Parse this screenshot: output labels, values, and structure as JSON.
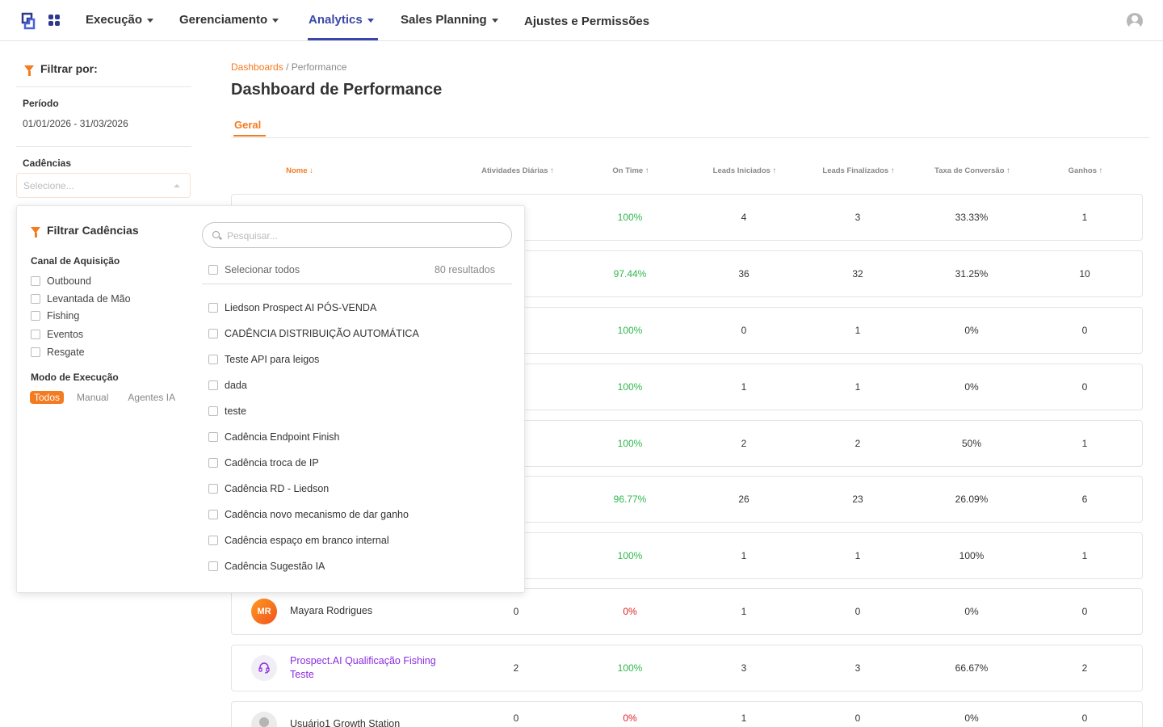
{
  "nav": {
    "items": [
      {
        "label": "Execução",
        "has_caret": true
      },
      {
        "label": "Gerenciamento",
        "has_caret": true
      },
      {
        "label": "Analytics",
        "has_caret": true,
        "active": true
      },
      {
        "label": "Sales Planning",
        "has_caret": true
      },
      {
        "label": "Ajustes e Permissões",
        "has_caret": false
      }
    ]
  },
  "sidebar": {
    "filter_title": "Filtrar por:",
    "period_label": "Período",
    "period_value": "01/01/2026 - 31/03/2026",
    "cadences_label": "Cadências",
    "cadences_placeholder": "Selecione..."
  },
  "breadcrumb": {
    "root": "Dashboards",
    "separator": "/",
    "current": "Performance"
  },
  "page_title": "Dashboard de Performance",
  "tabs": [
    "Geral"
  ],
  "table": {
    "headers": [
      {
        "label": "Nome",
        "arrow": "↓",
        "sorted": true
      },
      {
        "label": "Atividades Diárias",
        "arrow": "↑"
      },
      {
        "label": "On Time",
        "arrow": "↑"
      },
      {
        "label": "Leads Iniciados",
        "arrow": "↑"
      },
      {
        "label": "Leads Finalizados",
        "arrow": "↑"
      },
      {
        "label": "Taxa de Conversão",
        "arrow": "↑"
      },
      {
        "label": "Ganhos",
        "arrow": "↑"
      }
    ],
    "rows": [
      {
        "name": "",
        "activities": "",
        "on_time": "100%",
        "on_time_status": "good",
        "leads_started": "4",
        "leads_finished": "3",
        "conversion": "33.33%",
        "wins": "1"
      },
      {
        "name": "",
        "activities": "",
        "on_time": "97.44%",
        "on_time_status": "good",
        "leads_started": "36",
        "leads_finished": "32",
        "conversion": "31.25%",
        "wins": "10"
      },
      {
        "name": "",
        "activities": "",
        "on_time": "100%",
        "on_time_status": "good",
        "leads_started": "0",
        "leads_finished": "1",
        "conversion": "0%",
        "wins": "0"
      },
      {
        "name": "",
        "activities": "",
        "on_time": "100%",
        "on_time_status": "good",
        "leads_started": "1",
        "leads_finished": "1",
        "conversion": "0%",
        "wins": "0"
      },
      {
        "name": "",
        "activities": "",
        "on_time": "100%",
        "on_time_status": "good",
        "leads_started": "2",
        "leads_finished": "2",
        "conversion": "50%",
        "wins": "1"
      },
      {
        "name": "",
        "activities": "",
        "on_time": "96.77%",
        "on_time_status": "good",
        "leads_started": "26",
        "leads_finished": "23",
        "conversion": "26.09%",
        "wins": "6"
      },
      {
        "name": "",
        "activities": "",
        "on_time": "100%",
        "on_time_status": "good",
        "leads_started": "1",
        "leads_finished": "1",
        "conversion": "100%",
        "wins": "1"
      },
      {
        "name": "Mayara Rodrigues",
        "avatar_initials": "MR",
        "avatar_type": "initials",
        "activities": "0",
        "on_time": "0%",
        "on_time_status": "bad",
        "leads_started": "1",
        "leads_finished": "0",
        "conversion": "0%",
        "wins": "0"
      },
      {
        "name_line1": "Prospect.AI Qualificação Fishing",
        "name_line2": "Teste",
        "avatar_type": "ai-agent",
        "activities": "2",
        "on_time": "100%",
        "on_time_status": "good",
        "leads_started": "3",
        "leads_finished": "3",
        "conversion": "66.67%",
        "wins": "2"
      },
      {
        "name": "Usuário1 Growth Station",
        "avatar_type": "placeholder",
        "activities": "0",
        "on_time": "0%",
        "on_time_status": "bad",
        "leads_started": "1",
        "leads_finished": "0",
        "conversion": "0%",
        "wins": "0"
      }
    ]
  },
  "panel": {
    "title": "Filtrar Cadências",
    "acquisition_label": "Canal de Aquisição",
    "acquisition_options": [
      "Outbound",
      "Levantada de Mão",
      "Fishing",
      "Eventos",
      "Resgate"
    ],
    "mode_label": "Modo de Execução",
    "modes": [
      "Todos",
      "Manual",
      "Agentes IA"
    ],
    "selected_mode": "Todos",
    "search_placeholder": "Pesquisar...",
    "select_all_label": "Selecionar todos",
    "results_count": "80 resultados",
    "cadences": [
      "Liedson Prospect AI PÓS-VENDA",
      "CADÊNCIA DISTRIBUIÇÃO AUTOMÁTICA",
      "Teste API para leigos",
      "dada",
      "teste",
      "Cadência Endpoint Finish",
      "Cadência troca de IP",
      "Cadência RD - Liedson",
      "Cadência novo mecanismo de dar ganho",
      "Cadência espaço em branco internal",
      "Cadência Sugestão IA"
    ]
  },
  "colors": {
    "accent": "#f47b20",
    "nav_active": "#3b47a8",
    "good": "#2eb84d",
    "bad": "#e02424",
    "ai_name": "#8a2be2",
    "avatar_gradient": [
      "#ff9a1f",
      "#f0531f"
    ]
  },
  "icons": [
    "logo-icon",
    "apps-grid-icon",
    "user-avatar-icon",
    "funnel-icon",
    "search-icon",
    "headset-ai-icon"
  ]
}
